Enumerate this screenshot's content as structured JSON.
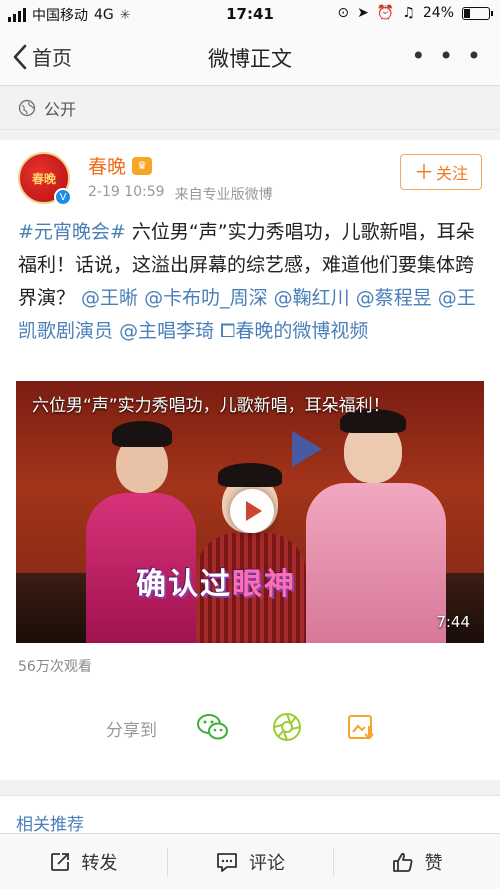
{
  "status_bar": {
    "carrier": "中国移动",
    "network": "4G",
    "time": "17:41",
    "battery": "24%",
    "battery_fraction": 0.24
  },
  "nav": {
    "back_label": "首页",
    "title": "微博正文",
    "more_label": "• • •"
  },
  "visibility": {
    "label": "公开"
  },
  "post": {
    "avatar_text": "春晚",
    "username": "春晚",
    "badge": "V",
    "time": "2-19 10:59",
    "source": "来自专业版微博",
    "follow_label": "关注",
    "text_parts": {
      "hashtag": "#元宵晚会#",
      "body": " 六位男“声”实力秀唱功，儿歌新唱，耳朵福利！话说，这溢出屏幕的综艺感，难道他们要集体跨界演？ ",
      "mention1": "@王晰",
      "mention2": "@卡布叻_周深",
      "mention3": "@鞠红川",
      "mention4": "@蔡程昱",
      "mention5": "@王凯歌剧演员",
      "mention6": "@主唱李琦",
      "video_link": "春晚的微博视频"
    },
    "video": {
      "title": "六位男“声”实力秀唱功，儿歌新唱，耳朵福利！",
      "caption_a": "确认过",
      "caption_b": "眼神",
      "duration": "7:44"
    },
    "views": "56万次观看",
    "share_label": "分享到"
  },
  "related": {
    "label": "相关推荐"
  },
  "bottom_bar": {
    "repost": "转发",
    "comment": "评论",
    "like": "赞"
  },
  "colors": {
    "accent_orange": "#f07a1f",
    "link_blue": "#4a7fb8",
    "wechat_green": "#3cb034",
    "moments_green": "#9acd32",
    "save_orange": "#f2a72c"
  }
}
